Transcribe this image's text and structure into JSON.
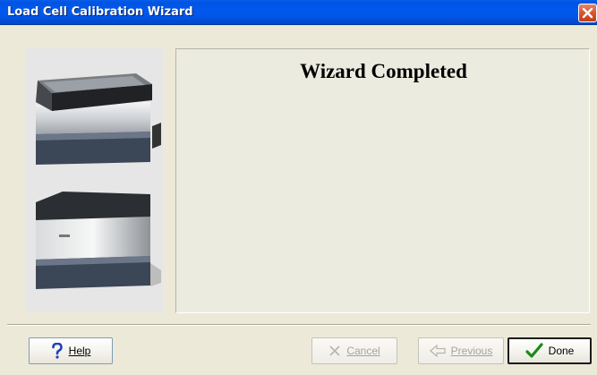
{
  "window": {
    "title": "Load Cell Calibration Wizard",
    "close_icon": "close-icon"
  },
  "main": {
    "heading": "Wizard Completed"
  },
  "buttons": {
    "help": {
      "label": "Help",
      "icon": "question-icon",
      "enabled": true
    },
    "cancel": {
      "label": "Cancel",
      "icon": "x-icon",
      "enabled": false
    },
    "previous": {
      "label": "Previous",
      "icon": "back-arrow-icon",
      "enabled": false
    },
    "done": {
      "label": "Done",
      "icon": "checkmark-icon",
      "enabled": true
    }
  },
  "colors": {
    "titlebar": "#0054e3",
    "close": "#d6572f",
    "help_icon": "#1f3fbf",
    "done_check": "#1a8a1a"
  }
}
